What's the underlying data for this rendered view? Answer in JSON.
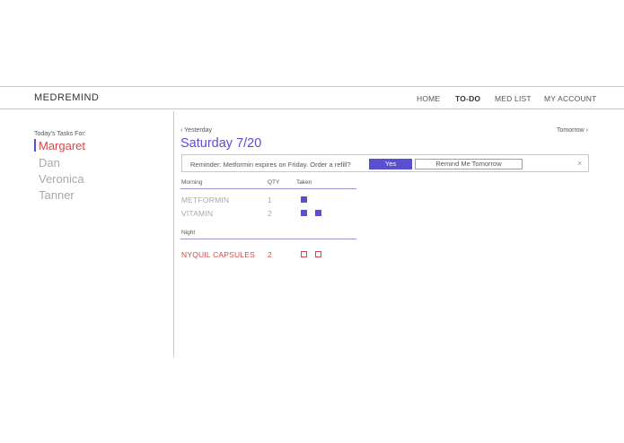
{
  "header": {
    "brand": "MEDREMIND",
    "nav": [
      "HOME",
      "TO-DO",
      "MED LIST",
      "MY ACCOUNT"
    ],
    "active_nav": "TO-DO"
  },
  "sidebar": {
    "tasks_for": "Today's Tasks For:",
    "people": [
      "Margaret",
      "Dan",
      "Veronica",
      "Tanner"
    ],
    "active_person": "Margaret"
  },
  "day": {
    "prev": "‹ Yesterday",
    "next": "Tomorrow ›",
    "title": "Saturday 7/20"
  },
  "reminder": {
    "text": "Reminder: Metformin expires on Friday. Order a refill?",
    "yes": "Yes",
    "later": "Remind Me Tomorrow",
    "close": "×"
  },
  "schedule": {
    "morning_label": "Morning",
    "qty_label": "QTY",
    "taken_label": "Taken",
    "morning": [
      {
        "name": "METFORMIN",
        "qty": "1",
        "taken": [
          true
        ]
      },
      {
        "name": "VITAMIN",
        "qty": "2",
        "taken": [
          true,
          true
        ]
      }
    ],
    "night_label": "Night",
    "night": [
      {
        "name": "NYQUIL CAPSULES",
        "qty": "2",
        "taken": [
          false,
          false
        ]
      }
    ]
  },
  "colors": {
    "accent": "#5a4fcf",
    "alert": "#d24a4a",
    "muted": "#a8a8a8"
  }
}
